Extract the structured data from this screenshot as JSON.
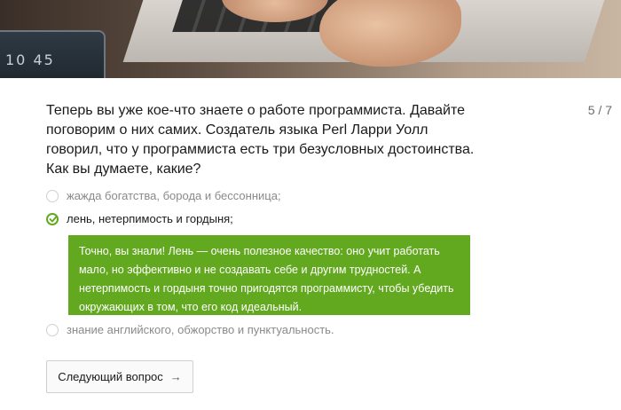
{
  "hero": {
    "phone_time": "10 45"
  },
  "progress": {
    "counter": "5 / 7"
  },
  "question": {
    "text": "Теперь вы уже кое-что знаете о работе программиста. Давайте поговорим о них самих. Создатель языка Perl Ларри Уолл говорил, что у программиста есть три безусловных достоинства. Как вы думаете, какие?"
  },
  "options": [
    {
      "label": "жажда богатства, борода и бессонница;",
      "selected": false
    },
    {
      "label": "лень, нетерпимость и гордыня;",
      "selected": true
    },
    {
      "label": "знание английского, обжорство и пунктуальность.",
      "selected": false
    }
  ],
  "feedback": {
    "text": "Точно, вы знали! Лень — очень полезное качество: оно учит работать мало, но эффективно и не создавать себе и другим трудностей. А нетерпимость и гордыня точно пригодятся программисту, чтобы убедить окружающих в том, что его код идеальный."
  },
  "next_button": {
    "label": "Следующий вопрос",
    "icon": "arrow-right-icon",
    "arrow": "→"
  },
  "colors": {
    "accent": "#62a920",
    "muted_text": "#8a8a8a"
  }
}
